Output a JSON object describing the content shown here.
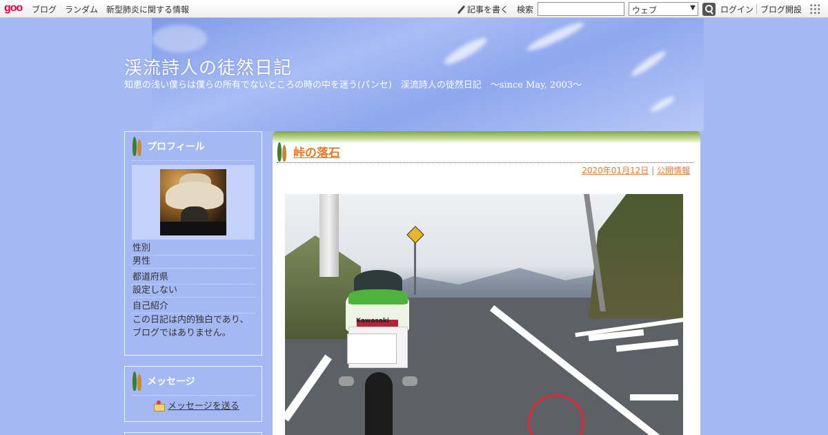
{
  "toolbar": {
    "logo": "goo",
    "nav": [
      "ブログ",
      "ランダム",
      "新型肺炎に関する情報"
    ],
    "write_label": "記事を書く",
    "search_label": "検索",
    "search_scope": "ウェブ",
    "login_label": "ログイン",
    "open_blog_label": "ブログ開設"
  },
  "header": {
    "title": "渓流詩人の徒然日記",
    "description": "知恵の浅い僕らは僕らの所有でないところの時の中を迷う(パンセ)　渓流詩人の徒然日記　～since May, 2003～"
  },
  "sidebar": {
    "profile": {
      "heading": "プロフィール",
      "fields": [
        {
          "label": "性別",
          "value": "男性"
        },
        {
          "label": "都道府県",
          "value": "設定しない"
        },
        {
          "label": "自己紹介",
          "value": "この日記は内的独白であり、ブログではありません。"
        }
      ]
    },
    "message": {
      "heading": "メッセージ",
      "link": "メッセージを送る"
    }
  },
  "article": {
    "title": "峠の落石",
    "date": "2020年01月12日",
    "separator": "|",
    "visibility": "公開情報",
    "photo_plate_text": "Kawasaki"
  },
  "colors": {
    "background": "#a4b8f4",
    "accent_link": "#e57a2c",
    "banner_green": "#7da63d"
  }
}
